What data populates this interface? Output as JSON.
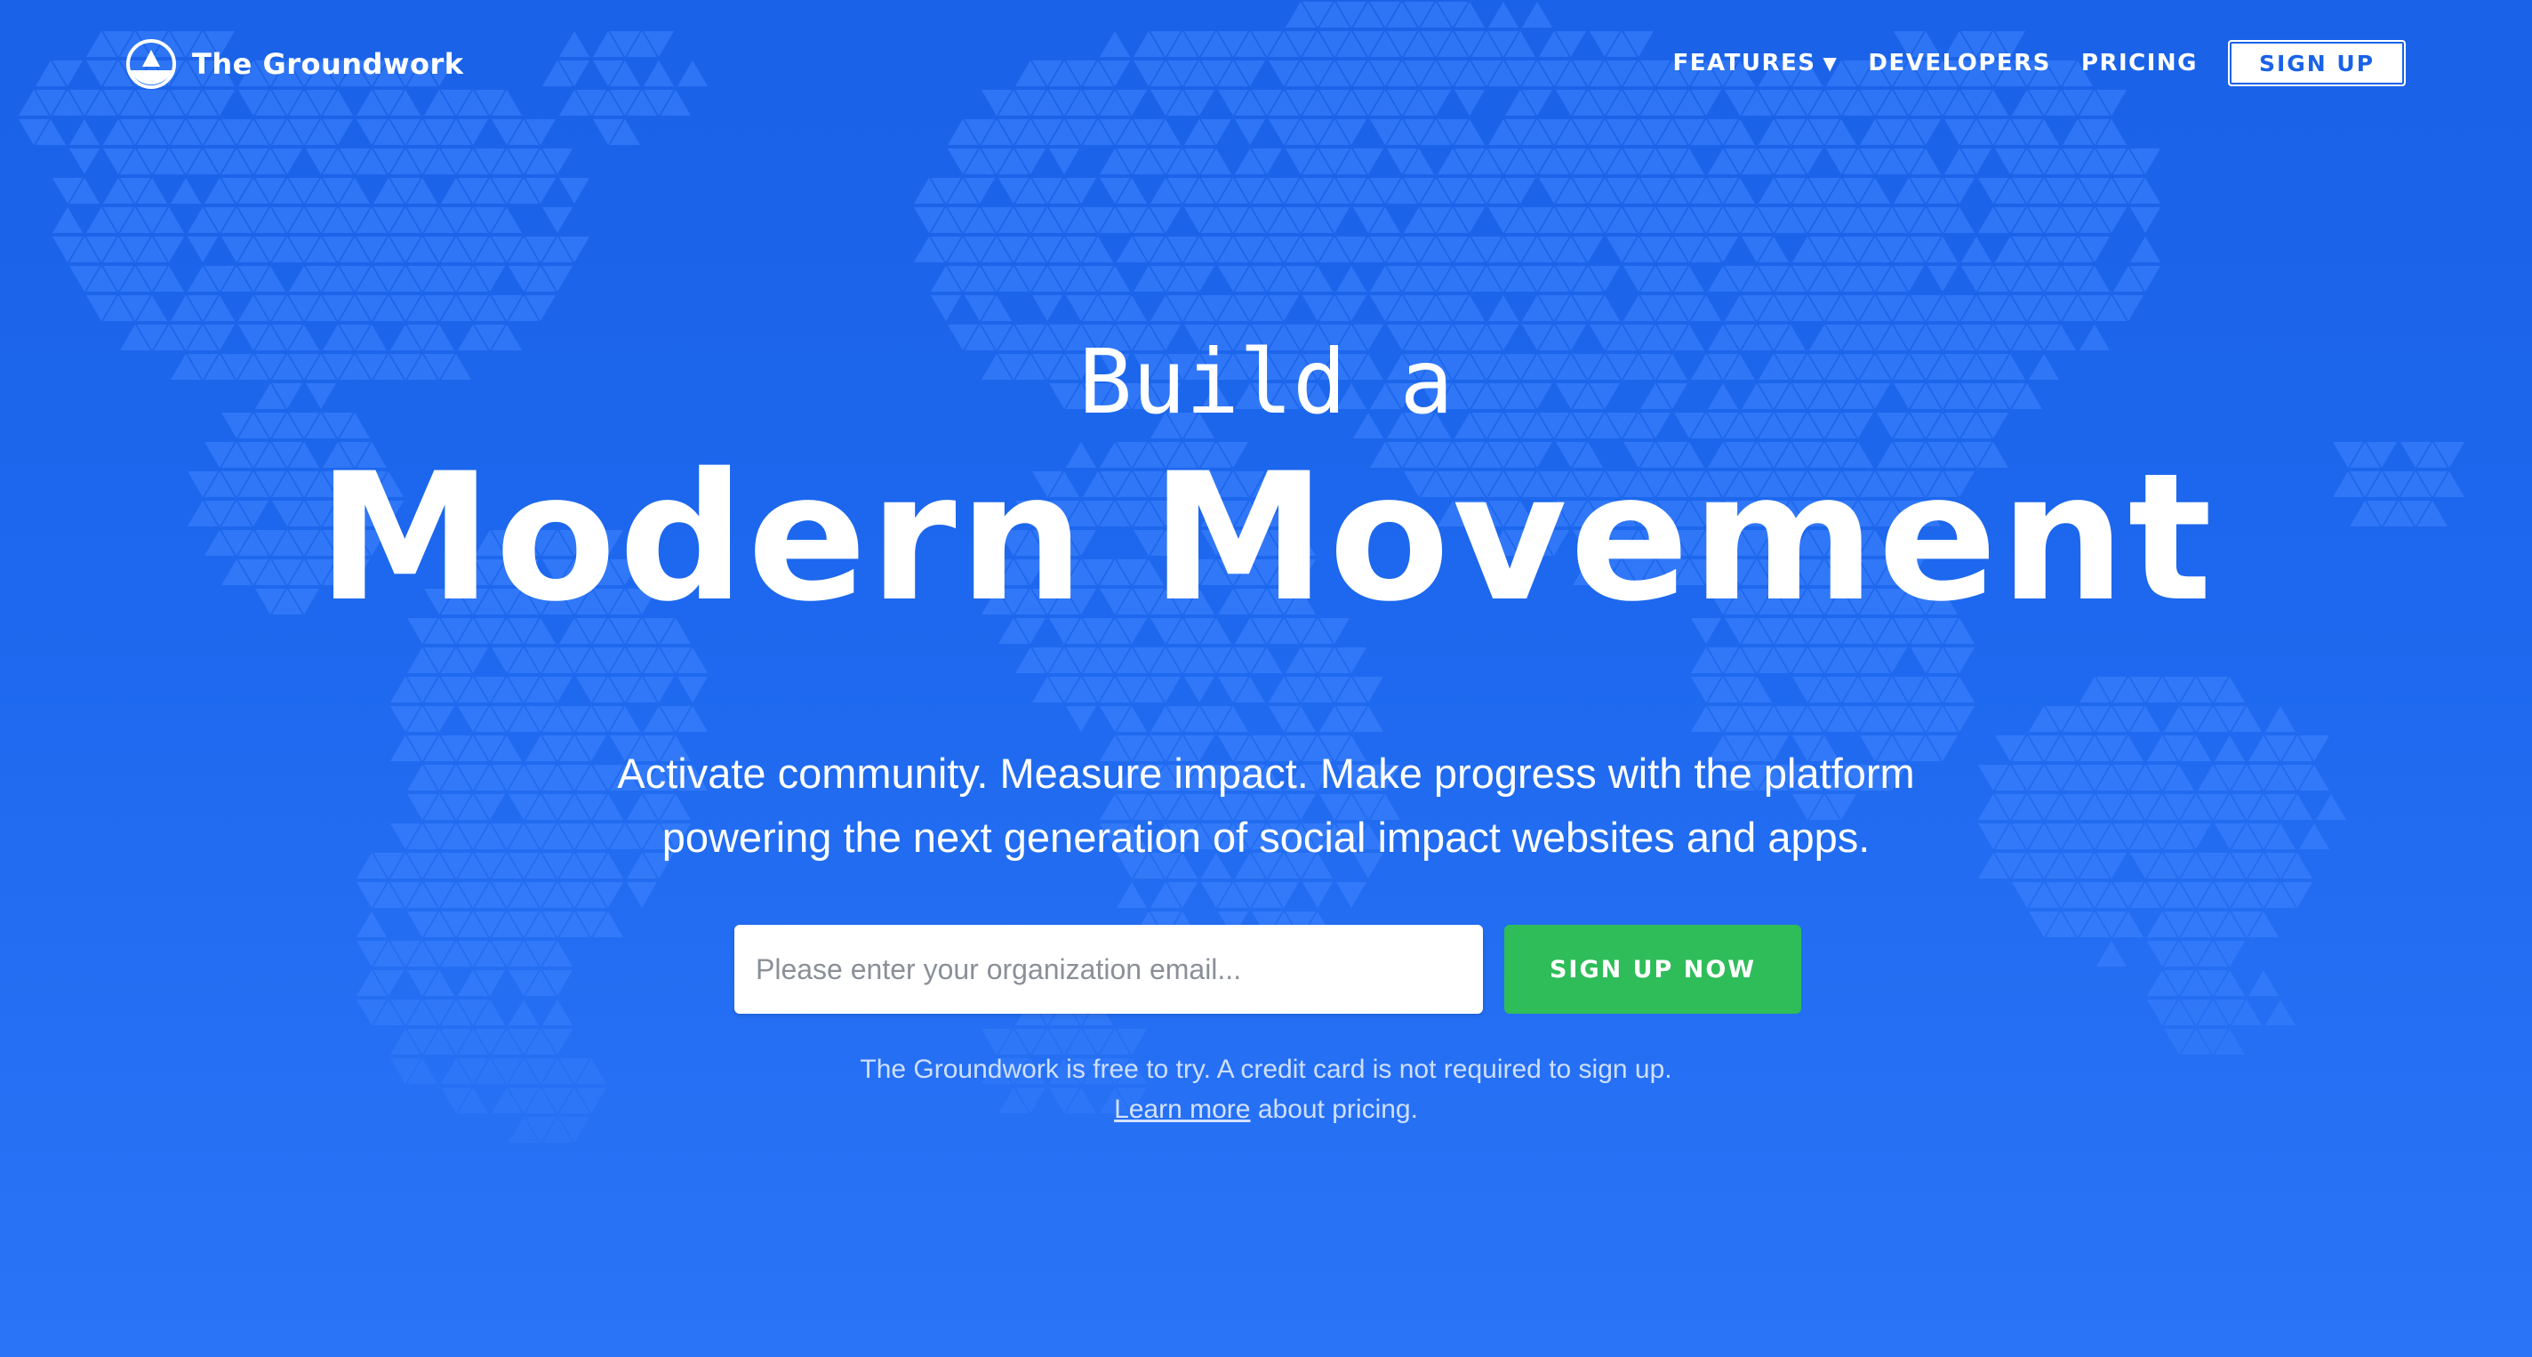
{
  "header": {
    "brand_name": "The Groundwork",
    "logo_icon": "triangle-in-circle-icon",
    "nav": {
      "features_label": "FEATURES",
      "developers_label": "DEVELOPERS",
      "pricing_label": "PRICING",
      "signup_label": "SIGN UP"
    }
  },
  "hero": {
    "pretitle": "Build a",
    "title": "Modern Movement",
    "subtitle_line1": "Activate community. Measure impact. Make progress with the platform",
    "subtitle_line2": "powering the next generation of social impact websites and apps."
  },
  "signup_form": {
    "email_placeholder": "Please enter your organization email...",
    "email_value": "",
    "cta_label": "SIGN UP NOW"
  },
  "fine_print": {
    "line1": "The Groundwork is free to try. A credit card is not required to sign up.",
    "link_text": "Learn more",
    "line2_rest": " about pricing."
  },
  "colors": {
    "background": "#1d68ee",
    "pattern": "#3f85ff",
    "cta": "#2ebd59",
    "text": "#ffffff"
  }
}
